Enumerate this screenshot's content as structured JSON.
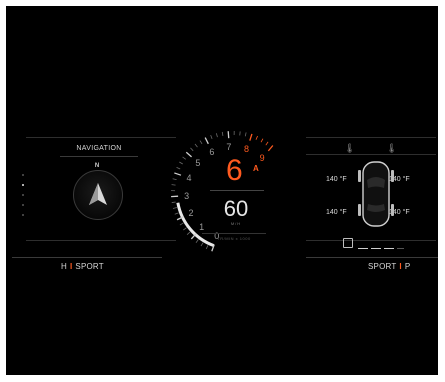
{
  "navigation": {
    "title": "NAVIGATION",
    "heading": "N"
  },
  "drive_modes": {
    "left": "H",
    "left_mode": "SPORT",
    "right_mode": "SPORT",
    "right": "P",
    "separator": "I"
  },
  "gauge": {
    "gear": "6",
    "gear_mode": "A",
    "speed": "60",
    "speed_unit": "M/H",
    "rpm_label": "TR/MIN x 1000",
    "ticks": [
      "0",
      "1",
      "2",
      "3",
      "4",
      "5",
      "6",
      "7",
      "8",
      "9"
    ],
    "redline_from": 8,
    "colors": {
      "accent": "#ff5a1f",
      "tick": "#9a9a9a"
    }
  },
  "tires": {
    "front_left": "140 °F",
    "front_right": "140 °F",
    "rear_left": "140 °F",
    "rear_right": "140 °F"
  },
  "icons": {
    "oil_temp": "oil-temperature-icon",
    "coolant_temp": "coolant-temperature-icon",
    "fuel": "fuel-icon"
  }
}
